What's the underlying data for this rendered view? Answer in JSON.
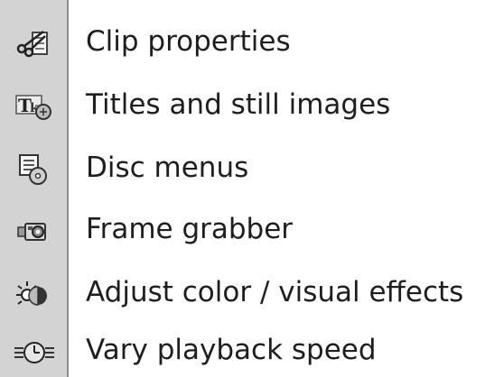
{
  "toolbar": {
    "bg_color": "#d3d3d3",
    "items": [
      {
        "label": "Clip properties",
        "icon": "scissors-clip-icon"
      },
      {
        "label": "Titles and still images",
        "icon": "title-text-icon"
      },
      {
        "label": "Disc menus",
        "icon": "disc-menu-icon"
      },
      {
        "label": "Frame grabber",
        "icon": "camera-grab-icon"
      },
      {
        "label": "Adjust color / visual effects",
        "icon": "color-effects-icon"
      },
      {
        "label": "Vary playback speed",
        "icon": "playback-speed-icon"
      }
    ]
  }
}
